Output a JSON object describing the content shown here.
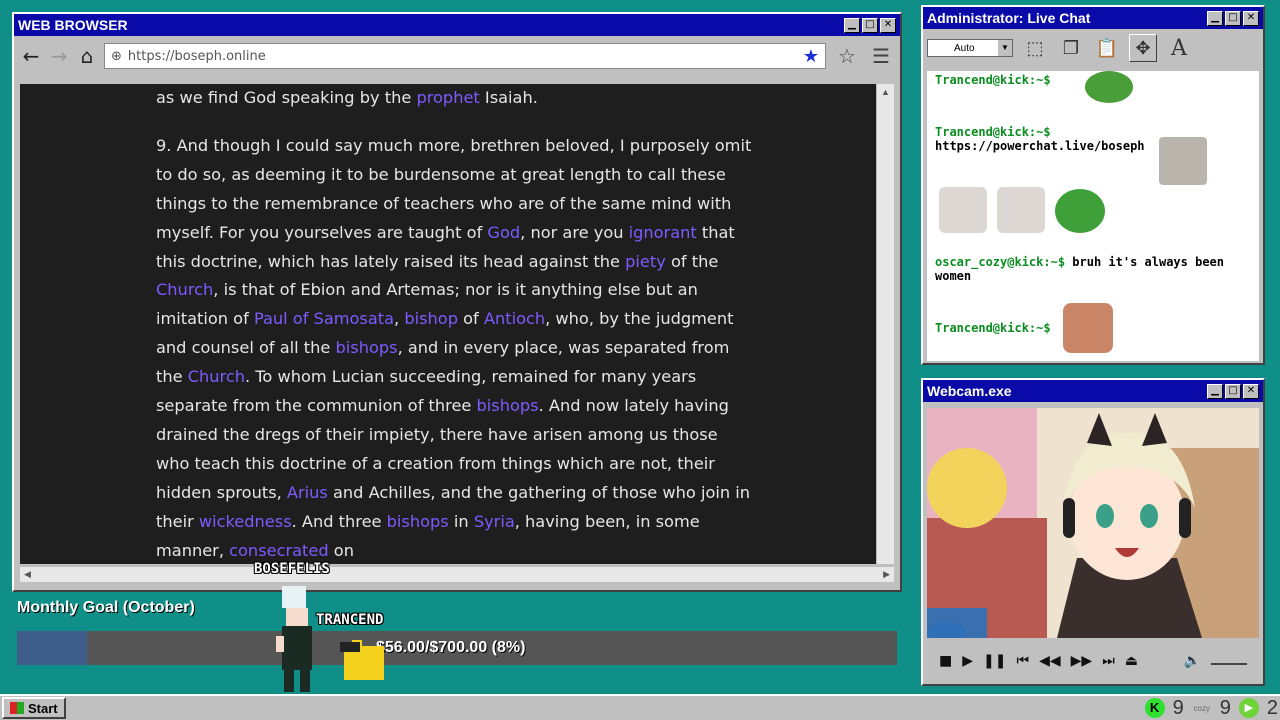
{
  "browser": {
    "title": "WEB BROWSER",
    "url": "https://boseph.online",
    "article": {
      "p0": [
        {
          "t": "as we find God speaking by the "
        },
        {
          "t": "prophet",
          "link": true
        },
        {
          "t": " Isaiah."
        }
      ],
      "p1": [
        {
          "t": "9. And though I could say much more, brethren beloved, I purposely omit to do so, as deeming it to be burdensome at great length to call these things to the remembrance of teachers who are of the same mind with myself. For you yourselves are taught of "
        },
        {
          "t": "God",
          "link": true
        },
        {
          "t": ", nor are you "
        },
        {
          "t": "ignorant",
          "link": true
        },
        {
          "t": " that this doctrine, which has lately raised its head against the "
        },
        {
          "t": "piety",
          "link": true
        },
        {
          "t": " of the "
        },
        {
          "t": "Church",
          "link": true
        },
        {
          "t": ", is that of Ebion and Artemas; nor is it anything else but an imitation of "
        },
        {
          "t": "Paul of Samosata",
          "link": true
        },
        {
          "t": ", "
        },
        {
          "t": "bishop",
          "link": true
        },
        {
          "t": " of "
        },
        {
          "t": "Antioch",
          "link": true
        },
        {
          "t": ", who, by the judgment and counsel of all the "
        },
        {
          "t": "bishops",
          "link": true
        },
        {
          "t": ", and in every place, was separated from the "
        },
        {
          "t": "Church",
          "link": true
        },
        {
          "t": ". To whom Lucian succeeding, remained for many years separate from the communion of three "
        },
        {
          "t": "bishops",
          "link": true
        },
        {
          "t": ". And now lately having drained the dregs of their impiety, there have arisen among us those who teach this doctrine of a creation from things which are not, their hidden sprouts, "
        },
        {
          "t": "Arius",
          "link": true
        },
        {
          "t": " and Achilles, and the gathering of those who join in their "
        },
        {
          "t": "wickedness",
          "link": true
        },
        {
          "t": ". And three "
        },
        {
          "t": "bishops",
          "link": true
        },
        {
          "t": " in "
        },
        {
          "t": "Syria",
          "link": true
        },
        {
          "t": ", having been, in some manner, "
        },
        {
          "t": "consecrated",
          "link": true
        },
        {
          "t": " on"
        }
      ]
    }
  },
  "chat": {
    "title": "Administrator: Live Chat",
    "font_select": "Auto",
    "messages": [
      {
        "user": "Trancend@kick:~$",
        "text": ""
      },
      {
        "user": "Trancend@kick:~$",
        "text": "https://powerchat.live/boseph"
      },
      {
        "user": "oscar_cozy@kick:~$",
        "text": "bruh it's always been women"
      },
      {
        "user": "Trancend@kick:~$",
        "text": ""
      }
    ]
  },
  "webcam": {
    "title": "Webcam.exe"
  },
  "goal": {
    "label": "Monthly Goal (October)",
    "amount": "$56.00/$700.00 (8%)",
    "fraction": 0.08
  },
  "overlay": {
    "name1": "BOSEFELIS",
    "name2": "TRANCEND"
  },
  "taskbar": {
    "start": "Start",
    "tray_count_1": "9",
    "tray_count_2": "9",
    "tray_count_3": "2",
    "cozy": "cozy"
  },
  "colors": {
    "desktop": "#0f8f87",
    "titlebar": "#0a0aa8",
    "link": "#7c5cff",
    "chat_user": "#0a8f20"
  }
}
